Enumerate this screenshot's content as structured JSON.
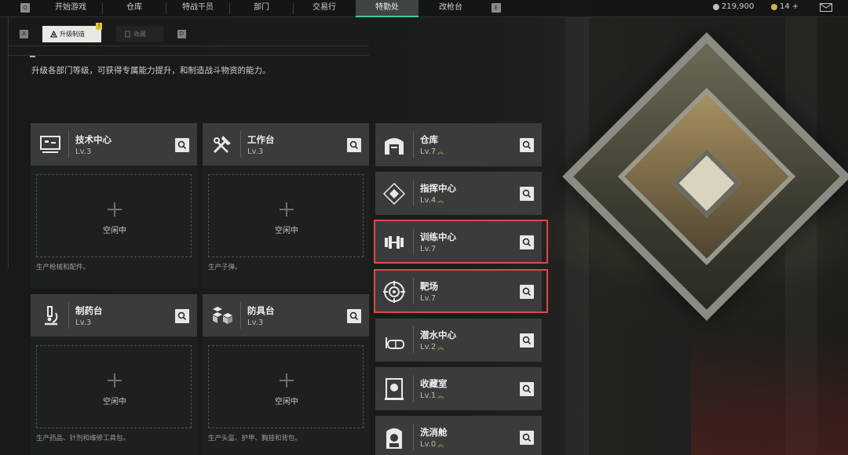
{
  "nav": {
    "left_key": "Q",
    "right_key": "E",
    "tabs": [
      {
        "label": "开始游戏"
      },
      {
        "label": "仓库"
      },
      {
        "label": "特战干员"
      },
      {
        "label": "部门"
      },
      {
        "label": "交易行"
      },
      {
        "label": "特勤处"
      },
      {
        "label": "改枪台"
      }
    ],
    "active_tab": "特勤处",
    "currency_amount": "219,900",
    "premium_amount": "14",
    "premium_plus": "+"
  },
  "subnav": {
    "left_key": "A",
    "right_key": "D",
    "tabs": [
      {
        "label": "升级制造"
      },
      {
        "label": "收藏"
      }
    ],
    "badge": "!"
  },
  "description": "升级各部门等级，可获得专属能力提升，和制造战斗物资的能力。",
  "cards": [
    {
      "title": "技术中心",
      "level": "Lv.3",
      "idle": "空闲中",
      "footer": "生产枪械和配件。",
      "icon": "computer-icon"
    },
    {
      "title": "工作台",
      "level": "Lv.3",
      "idle": "空闲中",
      "footer": "生产子弹。",
      "icon": "tools-icon"
    },
    {
      "title": "制药台",
      "level": "Lv.3",
      "idle": "空闲中",
      "footer": "生产药品、针剂和维修工具包。",
      "icon": "microscope-icon"
    },
    {
      "title": "防具台",
      "level": "Lv.3",
      "idle": "空闲中",
      "footer": "生产头盔、护甲、胸挂和背包。",
      "icon": "cubes-icon"
    }
  ],
  "facilities": [
    {
      "title": "仓库",
      "level": "Lv.7",
      "upgradable": true,
      "icon": "storage-icon"
    },
    {
      "title": "指挥中心",
      "level": "Lv.4",
      "upgradable": true,
      "icon": "command-icon"
    },
    {
      "title": "训练中心",
      "level": "Lv.7",
      "upgradable": false,
      "icon": "dumbbell-icon"
    },
    {
      "title": "靶场",
      "level": "Lv.7",
      "upgradable": false,
      "icon": "target-icon"
    },
    {
      "title": "潜水中心",
      "level": "Lv.2",
      "upgradable": true,
      "icon": "dive-mask-icon"
    },
    {
      "title": "收藏室",
      "level": "Lv.1",
      "upgradable": true,
      "icon": "collection-icon"
    },
    {
      "title": "洗消舱",
      "level": "Lv.0",
      "upgradable": true,
      "icon": "decon-icon"
    }
  ],
  "colors": {
    "accent": "#3fcf8e",
    "highlight": "#e0484a",
    "upgrade": "#c9a24a",
    "badge": "#e4c23a"
  }
}
